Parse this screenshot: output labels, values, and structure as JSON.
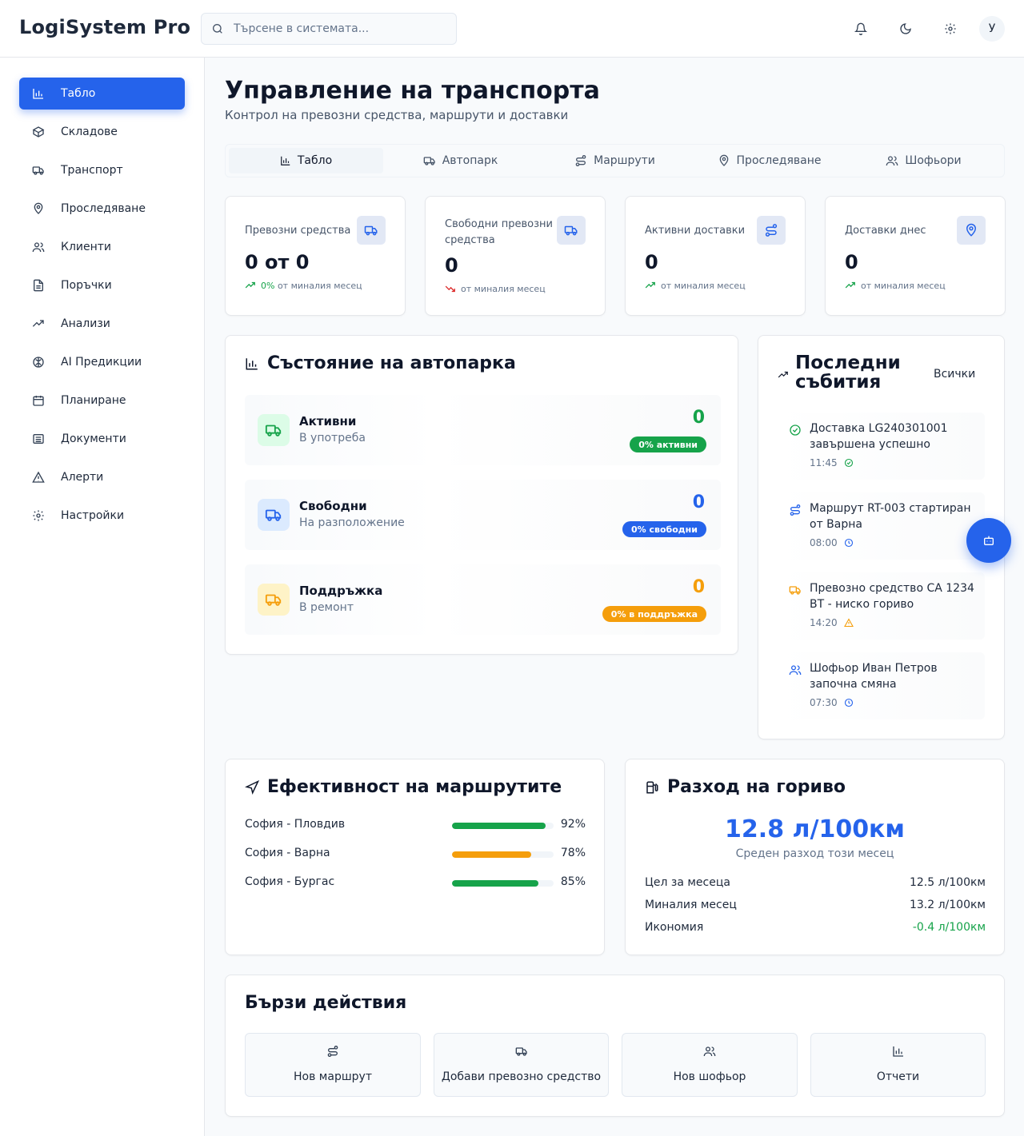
{
  "app": {
    "brand": "LogiSystem Pro"
  },
  "search": {
    "placeholder": "Търсене в системата..."
  },
  "user": {
    "avatar_initial": "У"
  },
  "sidebar": {
    "items": [
      {
        "label": "Табло",
        "icon": "chart-icon",
        "active": true
      },
      {
        "label": "Складове",
        "icon": "box-icon"
      },
      {
        "label": "Транспорт",
        "icon": "truck-icon"
      },
      {
        "label": "Проследяване",
        "icon": "map-pin-icon"
      },
      {
        "label": "Клиенти",
        "icon": "users-icon"
      },
      {
        "label": "Поръчки",
        "icon": "document-icon"
      },
      {
        "label": "Анализи",
        "icon": "trending-up-icon"
      },
      {
        "label": "AI Предикции",
        "icon": "brain-icon"
      },
      {
        "label": "Планиране",
        "icon": "calendar-icon"
      },
      {
        "label": "Документи",
        "icon": "archive-icon"
      },
      {
        "label": "Алерти",
        "icon": "alert-triangle-icon"
      },
      {
        "label": "Настройки",
        "icon": "gear-icon"
      }
    ]
  },
  "page": {
    "title": "Управление на транспорта",
    "subtitle": "Контрол на превозни средства, маршрути и доставки"
  },
  "tabs": [
    {
      "label": "Табло",
      "active": true
    },
    {
      "label": "Автопарк"
    },
    {
      "label": "Маршрути"
    },
    {
      "label": "Проследяване"
    },
    {
      "label": "Шофьори"
    }
  ],
  "stats": [
    {
      "label": "Превозни средства",
      "value": "0 от 0",
      "trend_pct": "0%",
      "trend_text": "от миналия месец",
      "trend": "up"
    },
    {
      "label": "Свободни превозни средства",
      "value": "0",
      "trend_pct": "",
      "trend_text": "от миналия месец",
      "trend": "down"
    },
    {
      "label": "Активни доставки",
      "value": "0",
      "trend_pct": "",
      "trend_text": "от миналия месец",
      "trend": "up"
    },
    {
      "label": "Доставки днес",
      "value": "0",
      "trend_pct": "",
      "trend_text": "от миналия месец",
      "trend": "up"
    }
  ],
  "fleet": {
    "title": "Състояние на автопарка",
    "rows": [
      {
        "title": "Активни",
        "sub": "В употреба",
        "value": "0",
        "badge": "0% активни",
        "color": "#16a34a",
        "bg": "#dcfce7"
      },
      {
        "title": "Свободни",
        "sub": "На разположение",
        "value": "0",
        "badge": "0% свободни",
        "color": "#2563eb",
        "bg": "#dbeafe"
      },
      {
        "title": "Поддръжка",
        "sub": "В ремонт",
        "value": "0",
        "badge": "0% в поддръжка",
        "color": "#f59e0b",
        "bg": "#fef3c7"
      }
    ]
  },
  "events": {
    "title_line1": "Последни",
    "title_line2": "събития",
    "all_label": "Всички",
    "items": [
      {
        "text": "Доставка LG240301001 завършена успешно",
        "time": "11:45",
        "icon": "check-circle-icon",
        "status_icon": "check-circle-icon",
        "color": "#16a34a"
      },
      {
        "text": "Маршрут RT-003 стартиран от Варна",
        "time": "08:00",
        "icon": "route-icon",
        "status_icon": "clock-icon",
        "color": "#2563eb"
      },
      {
        "text": "Превозно средство CA 1234 BT - ниско гориво",
        "time": "14:20",
        "icon": "truck-icon",
        "status_icon": "alert-triangle-icon",
        "color": "#f59e0b"
      },
      {
        "text": "Шофьор Иван Петров започна смяна",
        "time": "07:30",
        "icon": "users-icon",
        "status_icon": "clock-icon",
        "color": "#2563eb"
      }
    ]
  },
  "routes": {
    "title": "Ефективност на маршрутите",
    "items": [
      {
        "name": "София - Пловдив",
        "pct_label": "92%",
        "value": 0.92,
        "color": "#16a34a"
      },
      {
        "name": "София - Варна",
        "pct_label": "78%",
        "value": 0.78,
        "color": "#f59e0b"
      },
      {
        "name": "София - Бургас",
        "pct_label": "85%",
        "value": 0.85,
        "color": "#16a34a"
      }
    ]
  },
  "fuel": {
    "title": "Разход на гориво",
    "big_value": "12.8 л/100км",
    "big_label": "Среден разход този месец",
    "rows": [
      {
        "label": "Цел за месеца",
        "value": "12.5 л/100км"
      },
      {
        "label": "Миналия месец",
        "value": "13.2 л/100км"
      },
      {
        "label": "Икономия",
        "value": "-0.4 л/100км"
      }
    ]
  },
  "quick": {
    "title": "Бързи действия",
    "items": [
      {
        "label": "Нов маршрут",
        "icon": "route-icon"
      },
      {
        "label": "Добави превозно средство",
        "icon": "truck-icon"
      },
      {
        "label": "Нов шофьор",
        "icon": "users-icon"
      },
      {
        "label": "Отчети",
        "icon": "chart-icon"
      }
    ]
  },
  "colors": {
    "accent": "#2563eb",
    "success": "#16a34a",
    "warning": "#f59e0b",
    "danger": "#dc2626"
  }
}
